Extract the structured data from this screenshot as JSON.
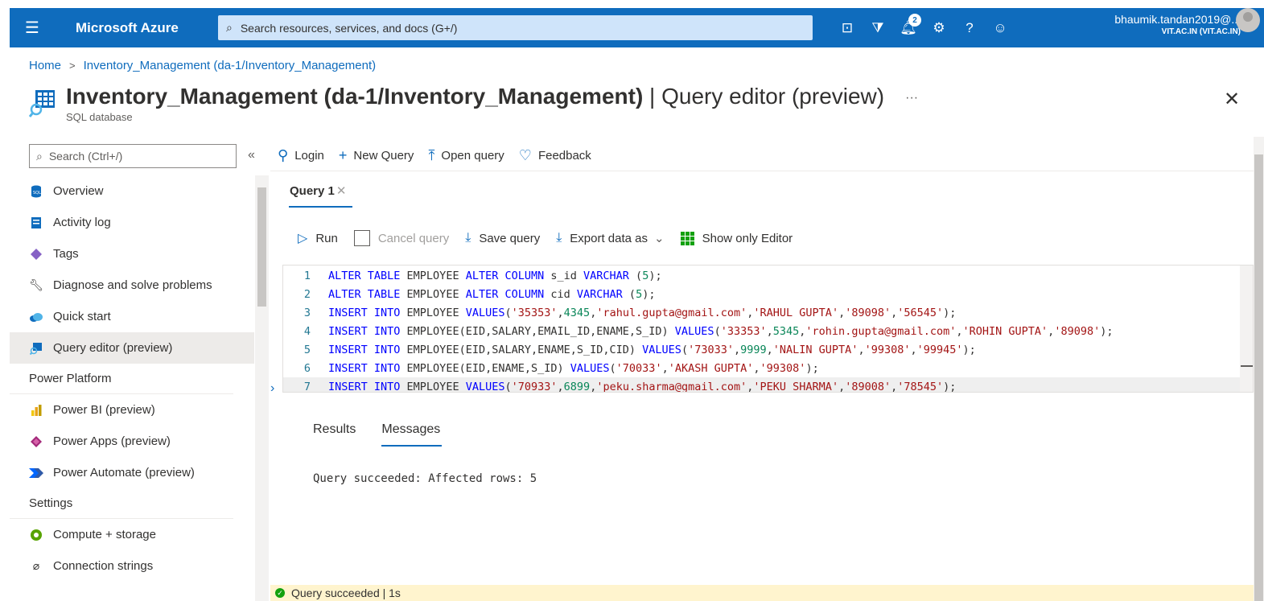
{
  "topbar": {
    "brand": "Microsoft Azure",
    "search_placeholder": "Search resources, services, and docs (G+/)",
    "notification_count": "2",
    "account_name": "bhaumik.tandan2019@...",
    "account_tenant": "VIT.AC.IN (VIT.AC.IN)",
    "accent_color": "#0f6cbd"
  },
  "breadcrumb": {
    "home": "Home",
    "current": "Inventory_Management (da-1/Inventory_Management)"
  },
  "page": {
    "title_bold": "Inventory_Management (da-1/Inventory_Management)",
    "title_sep": " | ",
    "title_rest": "Query editor (preview)",
    "more": "···",
    "subtitle": "SQL database",
    "close": "✕"
  },
  "sidebar": {
    "search_placeholder": "Search (Ctrl+/)",
    "collapse": "«",
    "items": [
      {
        "label": "Overview",
        "icon": "sql-db-icon"
      },
      {
        "label": "Activity log",
        "icon": "activity-log-icon"
      },
      {
        "label": "Tags",
        "icon": "tag-icon"
      },
      {
        "label": "Diagnose and solve problems",
        "icon": "wrench-icon"
      },
      {
        "label": "Quick start",
        "icon": "cloud-icon"
      },
      {
        "label": "Query editor (preview)",
        "icon": "query-editor-icon"
      }
    ],
    "section_power": "Power Platform",
    "power_items": [
      {
        "label": "Power BI (preview)",
        "icon": "power-bi-icon"
      },
      {
        "label": "Power Apps (preview)",
        "icon": "power-apps-icon"
      },
      {
        "label": "Power Automate (preview)",
        "icon": "power-automate-icon"
      }
    ],
    "section_settings": "Settings",
    "settings_items": [
      {
        "label": "Compute + storage",
        "icon": "compute-icon"
      },
      {
        "label": "Connection strings",
        "icon": "plug-icon"
      }
    ]
  },
  "commands": {
    "login": "Login",
    "new_query": "New Query",
    "open_query": "Open query",
    "feedback": "Feedback"
  },
  "editor_tab": {
    "label": "Query 1",
    "close": "✕"
  },
  "query_toolbar": {
    "run": "Run",
    "cancel": "Cancel query",
    "save": "Save query",
    "export": "Export data as",
    "show_only": "Show only Editor"
  },
  "code": [
    {
      "n": "1",
      "tokens": [
        [
          "kw",
          "ALTER TABLE "
        ],
        [
          "",
          "EMPLOYEE "
        ],
        [
          "kw",
          "ALTER COLUMN "
        ],
        [
          "",
          "s_id "
        ],
        [
          "kw",
          "VARCHAR "
        ],
        [
          "",
          "("
        ],
        [
          "num",
          "5"
        ],
        [
          "",
          ");"
        ]
      ]
    },
    {
      "n": "2",
      "tokens": [
        [
          "kw",
          "ALTER TABLE "
        ],
        [
          "",
          "EMPLOYEE "
        ],
        [
          "kw",
          "ALTER COLUMN "
        ],
        [
          "",
          "cid "
        ],
        [
          "kw",
          "VARCHAR "
        ],
        [
          "",
          "("
        ],
        [
          "num",
          "5"
        ],
        [
          "",
          ");"
        ]
      ]
    },
    {
      "n": "3",
      "tokens": [
        [
          "kw",
          "INSERT INTO "
        ],
        [
          "",
          "EMPLOYEE "
        ],
        [
          "kw",
          "VALUES"
        ],
        [
          "",
          "("
        ],
        [
          "str",
          "'35353'"
        ],
        [
          "",
          ","
        ],
        [
          "num",
          "4345"
        ],
        [
          "",
          ","
        ],
        [
          "str",
          "'rahul.gupta@gmail.com'"
        ],
        [
          "",
          ","
        ],
        [
          "str",
          "'RAHUL GUPTA'"
        ],
        [
          "",
          ","
        ],
        [
          "str",
          "'89098'"
        ],
        [
          "",
          ","
        ],
        [
          "str",
          "'56545'"
        ],
        [
          "",
          ");"
        ]
      ]
    },
    {
      "n": "4",
      "tokens": [
        [
          "kw",
          "INSERT INTO "
        ],
        [
          "",
          "EMPLOYEE(EID,SALARY,EMAIL_ID,ENAME,S_ID) "
        ],
        [
          "kw",
          "VALUES"
        ],
        [
          "",
          "("
        ],
        [
          "str",
          "'33353'"
        ],
        [
          "",
          ","
        ],
        [
          "num",
          "5345"
        ],
        [
          "",
          ","
        ],
        [
          "str",
          "'rohin.gupta@gmail.com'"
        ],
        [
          "",
          ","
        ],
        [
          "str",
          "'ROHIN GUPTA'"
        ],
        [
          "",
          ","
        ],
        [
          "str",
          "'89098'"
        ],
        [
          "",
          ");"
        ]
      ]
    },
    {
      "n": "5",
      "tokens": [
        [
          "kw",
          "INSERT INTO "
        ],
        [
          "",
          "EMPLOYEE(EID,SALARY,ENAME,S_ID,CID) "
        ],
        [
          "kw",
          "VALUES"
        ],
        [
          "",
          "("
        ],
        [
          "str",
          "'73033'"
        ],
        [
          "",
          ","
        ],
        [
          "num",
          "9999"
        ],
        [
          "",
          ","
        ],
        [
          "str",
          "'NALIN GUPTA'"
        ],
        [
          "",
          ","
        ],
        [
          "str",
          "'99308'"
        ],
        [
          "",
          ","
        ],
        [
          "str",
          "'99945'"
        ],
        [
          "",
          ");"
        ]
      ]
    },
    {
      "n": "6",
      "tokens": [
        [
          "kw",
          "INSERT INTO "
        ],
        [
          "",
          "EMPLOYEE(EID,ENAME,S_ID) "
        ],
        [
          "kw",
          "VALUES"
        ],
        [
          "",
          "("
        ],
        [
          "str",
          "'70033'"
        ],
        [
          "",
          ","
        ],
        [
          "str",
          "'AKASH GUPTA'"
        ],
        [
          "",
          ","
        ],
        [
          "str",
          "'99308'"
        ],
        [
          "",
          ");"
        ]
      ]
    },
    {
      "n": "7",
      "tokens": [
        [
          "kw",
          "INSERT INTO "
        ],
        [
          "",
          "EMPLOYEE "
        ],
        [
          "kw",
          "VALUES"
        ],
        [
          "",
          "("
        ],
        [
          "str",
          "'70933'"
        ],
        [
          "",
          ","
        ],
        [
          "num",
          "6899"
        ],
        [
          "",
          ","
        ],
        [
          "str",
          "'peku.sharma@gmail.com'"
        ],
        [
          "",
          ","
        ],
        [
          "str",
          "'PEKU SHARMA'"
        ],
        [
          "",
          ","
        ],
        [
          "str",
          "'89008'"
        ],
        [
          "",
          ","
        ],
        [
          "str",
          "'78545'"
        ],
        [
          "",
          ");"
        ]
      ]
    }
  ],
  "results": {
    "tab_results": "Results",
    "tab_messages": "Messages",
    "message": "Query succeeded: Affected rows: 5"
  },
  "status": {
    "text": "Query succeeded | 1s",
    "color": "#13a10e"
  }
}
